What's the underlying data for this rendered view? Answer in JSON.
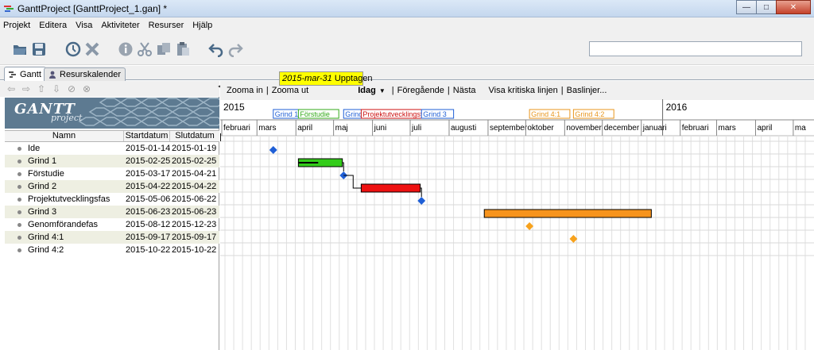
{
  "window": {
    "title": "GanttProject [GanttProject_1.gan] *",
    "minimize": "—",
    "maximize": "□",
    "close": "✕"
  },
  "menu": [
    "Projekt",
    "Editera",
    "Visa",
    "Aktiviteter",
    "Resurser",
    "Hjälp"
  ],
  "toolbar_icons": [
    "open-folder-icon",
    "save-icon",
    "clock-icon",
    "delete-x-icon",
    "info-icon",
    "cut-icon",
    "copy-icon",
    "paste-icon",
    "undo-icon",
    "redo-icon"
  ],
  "search": {
    "value": "",
    "placeholder": ""
  },
  "tabs": [
    {
      "label": "Gantt",
      "icon": "gantt-icon",
      "active": true
    },
    {
      "label": "Resurskalender",
      "icon": "resource-icon",
      "active": false
    }
  ],
  "logo": {
    "word": "GANTT",
    "sub": "project"
  },
  "table": {
    "headers": [
      "Namn",
      "Startdatum",
      "Slutdatum"
    ],
    "rows": [
      {
        "name": "Ide",
        "start": "2015-01-14",
        "end": "2015-01-19"
      },
      {
        "name": "Grind 1",
        "start": "2015-02-25",
        "end": "2015-02-25"
      },
      {
        "name": "Förstudie",
        "start": "2015-03-17",
        "end": "2015-04-21"
      },
      {
        "name": "Grind 2",
        "start": "2015-04-22",
        "end": "2015-04-22"
      },
      {
        "name": "Projektutvecklingsfas",
        "start": "2015-05-06",
        "end": "2015-06-22"
      },
      {
        "name": "Grind 3",
        "start": "2015-06-23",
        "end": "2015-06-23"
      },
      {
        "name": "Genomförandefas",
        "start": "2015-08-12",
        "end": "2015-12-23"
      },
      {
        "name": "Grind 4:1",
        "start": "2015-09-17",
        "end": "2015-09-17"
      },
      {
        "name": "Grind 4:2",
        "start": "2015-10-22",
        "end": "2015-10-22"
      }
    ]
  },
  "gantt_toolbar": {
    "zoom_in": "Zooma in",
    "sep1": "|",
    "zoom_out": "Zooma ut",
    "today": "Idag",
    "sep2": "|",
    "previous": "Föregående",
    "sep3": "|",
    "next": "Nästa",
    "critical": "Visa kritiska linjen",
    "sep4": "|",
    "baselines": "Baslinjer..."
  },
  "tooltip": {
    "date": "2015-mar-31",
    "text": "Upptagen"
  },
  "timeline": {
    "years": [
      "2015",
      "2016"
    ],
    "months": [
      "februari",
      "mars",
      "april",
      "maj",
      "juni",
      "juli",
      "augusti",
      "september",
      "oktober",
      "november",
      "december",
      "januari",
      "februari",
      "mars",
      "april",
      "ma"
    ]
  },
  "chart_data": {
    "type": "gantt",
    "start_date": "2015-01-15",
    "tasks": [
      {
        "name": "Ide",
        "start": "2015-01-14",
        "end": "2015-01-19",
        "kind": "task",
        "color": "#000000"
      },
      {
        "name": "Grind 1",
        "start": "2015-02-25",
        "end": "2015-02-25",
        "kind": "milestone",
        "color": "#1f5fd6"
      },
      {
        "name": "Förstudie",
        "start": "2015-03-17",
        "end": "2015-04-21",
        "kind": "task",
        "color": "#33cc1a",
        "progress": 0.45
      },
      {
        "name": "Grind 2",
        "start": "2015-04-22",
        "end": "2015-04-22",
        "kind": "milestone",
        "color": "#1f5fd6"
      },
      {
        "name": "Projektutvecklingsfas",
        "start": "2015-05-06",
        "end": "2015-06-22",
        "kind": "task",
        "color": "#ee1111"
      },
      {
        "name": "Grind 3",
        "start": "2015-06-23",
        "end": "2015-06-23",
        "kind": "milestone",
        "color": "#1f5fd6"
      },
      {
        "name": "Genomförandefas",
        "start": "2015-08-12",
        "end": "2015-12-23",
        "kind": "task",
        "color": "#f7941d"
      },
      {
        "name": "Grind 4:1",
        "start": "2015-09-17",
        "end": "2015-09-17",
        "kind": "milestone",
        "color": "#f7a21d"
      },
      {
        "name": "Grind 4:2",
        "start": "2015-10-22",
        "end": "2015-10-22",
        "kind": "milestone",
        "color": "#f7a21d"
      }
    ],
    "flags": [
      {
        "label": "Grind 1",
        "date": "2015-02-25",
        "color": "#1f5fd6"
      },
      {
        "label": "Förstudie",
        "date": "2015-03-17",
        "color": "#33aa1a"
      },
      {
        "label": "Grind 2",
        "date": "2015-04-22",
        "color": "#1f5fd6"
      },
      {
        "label": "Projektutvecklingsfas",
        "date": "2015-05-06",
        "color": "#cc1111"
      },
      {
        "label": "Grind 3",
        "date": "2015-06-23",
        "color": "#1f5fd6"
      },
      {
        "label": "Grind 4:1",
        "date": "2015-09-17",
        "color": "#e8961d"
      },
      {
        "label": "Grind 4:2",
        "date": "2015-10-22",
        "color": "#e8961d"
      }
    ],
    "dependencies": [
      {
        "from": "Förstudie",
        "to": "Grind 2"
      },
      {
        "from": "Grind 2",
        "to": "Projektutvecklingsfas"
      },
      {
        "from": "Projektutvecklingsfas",
        "to": "Grind 3"
      }
    ]
  }
}
